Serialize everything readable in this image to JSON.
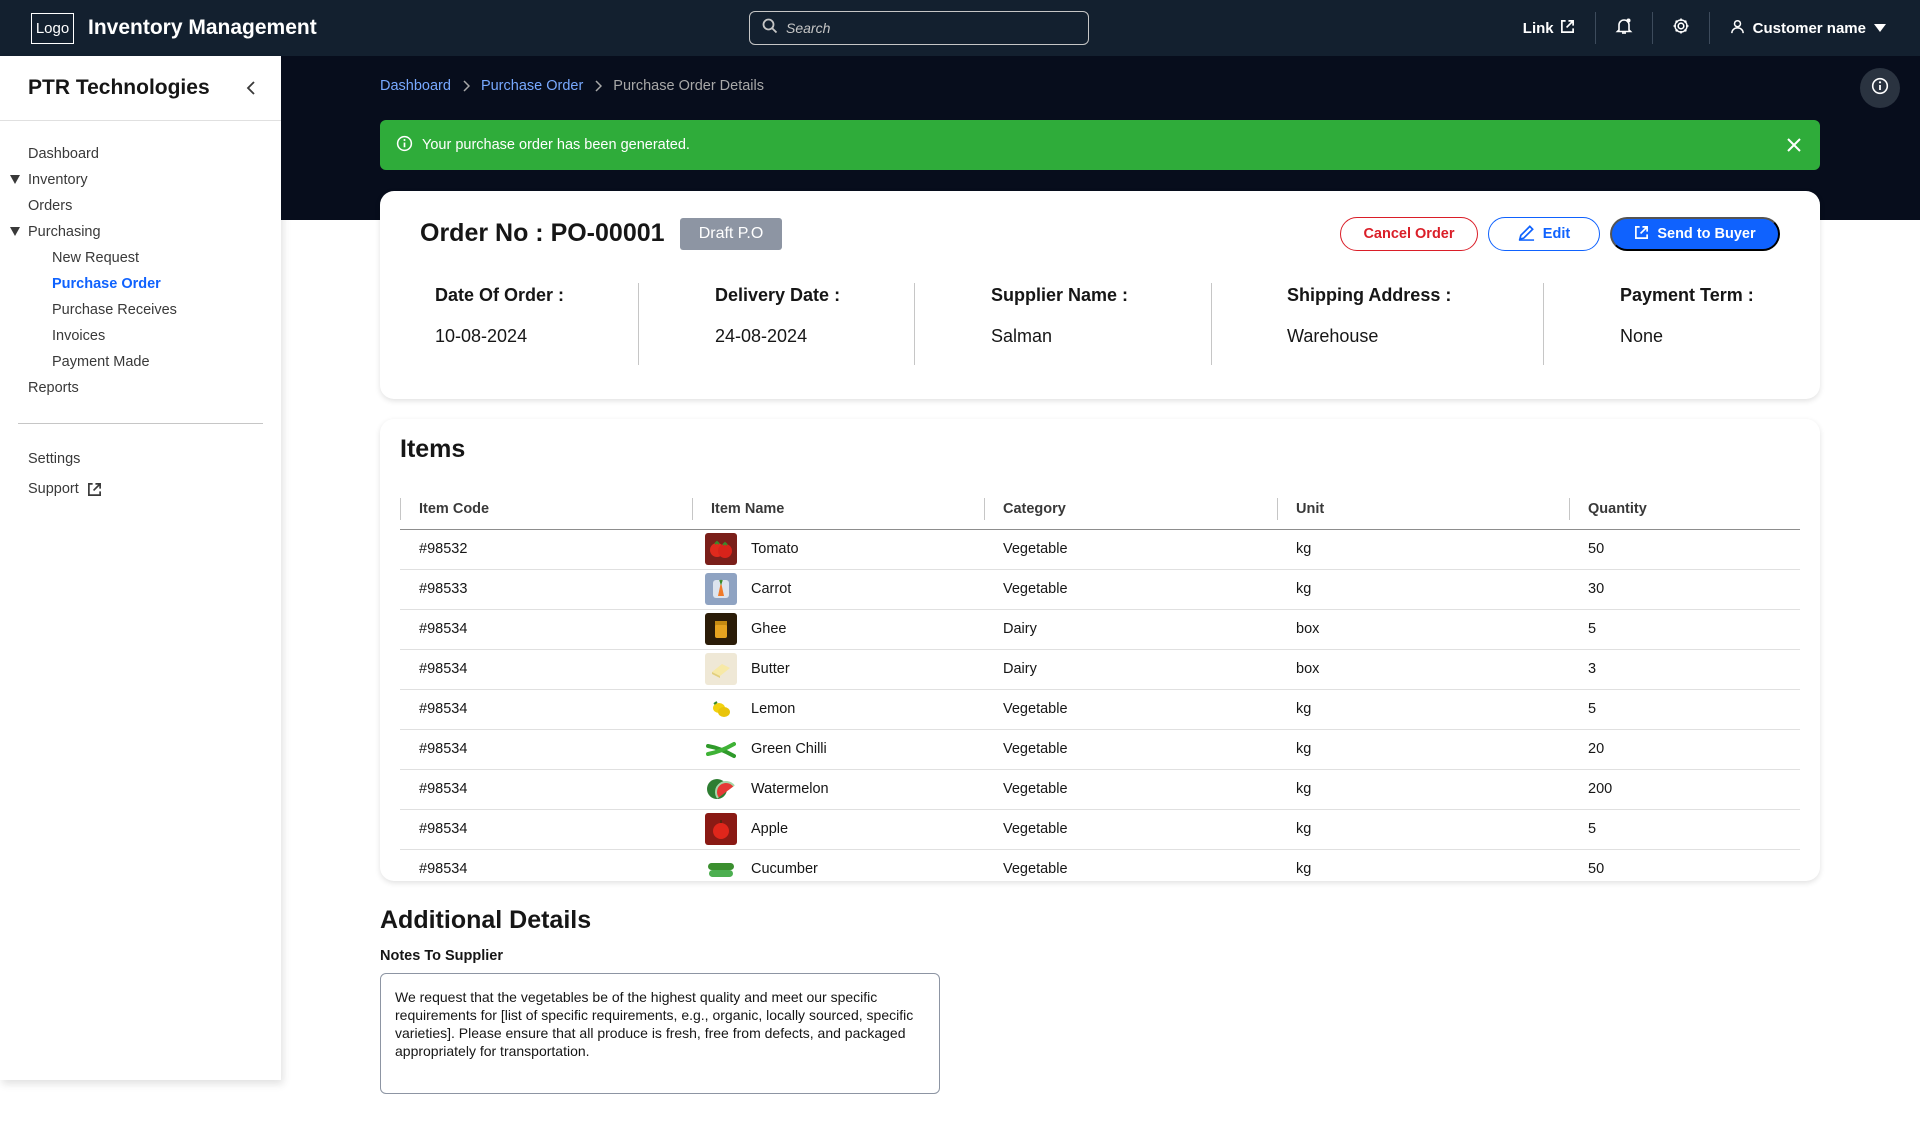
{
  "topbar": {
    "logo": "Logo",
    "title": "Inventory Management",
    "search_placeholder": "Search",
    "link_label": "Link",
    "user_name": "Customer name"
  },
  "sidebar": {
    "org_name": "PTR Technologies",
    "items": [
      {
        "label": "Dashboard"
      },
      {
        "label": "Inventory"
      },
      {
        "label": "Orders"
      },
      {
        "label": "Purchasing"
      },
      {
        "label": "New Request"
      },
      {
        "label": "Purchase Order"
      },
      {
        "label": "Purchase Receives"
      },
      {
        "label": "Invoices"
      },
      {
        "label": "Payment Made"
      },
      {
        "label": "Reports"
      }
    ],
    "settings": "Settings",
    "support": "Support"
  },
  "breadcrumb": {
    "items": [
      "Dashboard",
      "Purchase Order",
      "Purchase Order Details"
    ]
  },
  "toast": {
    "message": "Your purchase order has been generated."
  },
  "order": {
    "title": "Order No : PO-00001",
    "status": "Draft P.O",
    "cancel_label": "Cancel Order",
    "edit_label": "Edit",
    "send_label": "Send to Buyer",
    "fields": [
      {
        "label": "Date Of Order :",
        "value": "10-08-2024"
      },
      {
        "label": "Delivery Date :",
        "value": "24-08-2024"
      },
      {
        "label": "Supplier Name :",
        "value": "Salman"
      },
      {
        "label": "Shipping Address :",
        "value": "Warehouse"
      },
      {
        "label": "Payment Term :",
        "value": "None"
      }
    ]
  },
  "items": {
    "title": "Items",
    "columns": [
      "Item Code",
      "Item Name",
      "Category",
      "Unit",
      "Quantity"
    ],
    "rows": [
      {
        "code": "#98532",
        "name": "Tomato",
        "icon": "tomato-icon",
        "category": "Vegetable",
        "unit": "kg",
        "qty": "50"
      },
      {
        "code": "#98533",
        "name": "Carrot",
        "icon": "carrot-icon",
        "category": "Vegetable",
        "unit": "kg",
        "qty": "30"
      },
      {
        "code": "#98534",
        "name": "Ghee",
        "icon": "ghee-icon",
        "category": "Dairy",
        "unit": "box",
        "qty": "5"
      },
      {
        "code": "#98534",
        "name": "Butter",
        "icon": "butter-icon",
        "category": "Dairy",
        "unit": "box",
        "qty": "3"
      },
      {
        "code": "#98534",
        "name": "Lemon",
        "icon": "lemon-icon",
        "category": "Vegetable",
        "unit": "kg",
        "qty": "5"
      },
      {
        "code": "#98534",
        "name": "Green Chilli",
        "icon": "green-chilli-icon",
        "category": "Vegetable",
        "unit": "kg",
        "qty": "20"
      },
      {
        "code": "#98534",
        "name": "Watermelon",
        "icon": "watermelon-icon",
        "category": "Vegetable",
        "unit": "kg",
        "qty": "200"
      },
      {
        "code": "#98534",
        "name": "Apple",
        "icon": "apple-icon",
        "category": "Vegetable",
        "unit": "kg",
        "qty": "5"
      },
      {
        "code": "#98534",
        "name": "Cucumber",
        "icon": "cucumber-icon",
        "category": "Vegetable",
        "unit": "kg",
        "qty": "50"
      }
    ]
  },
  "additional": {
    "title": "Additional Details",
    "notes_label": "Notes To Supplier",
    "notes_text": "We request that the vegetables be of the highest quality and meet our specific requirements for [list of specific requirements, e.g., organic, locally sourced, specific varieties]. Please ensure that all produce is fresh, free from defects, and packaged appropriately for transportation."
  },
  "colors": {
    "topbar": "#13202f",
    "hero": "#070d1c",
    "accent": "#0f62fe",
    "success": "#2fac3a",
    "danger": "#da1e28",
    "badge": "#8d95a3"
  }
}
